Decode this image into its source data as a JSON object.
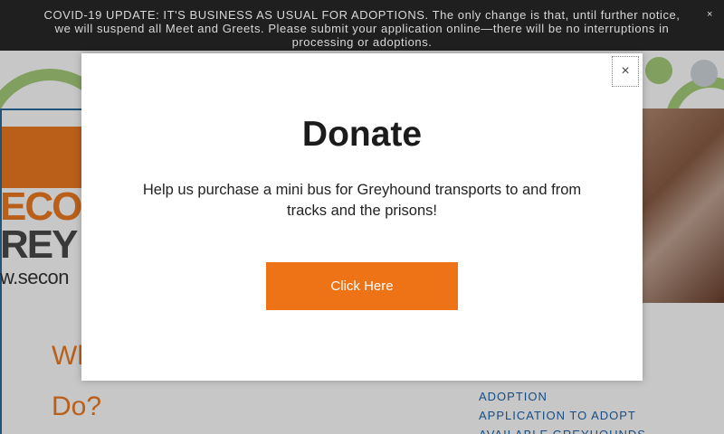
{
  "notice_bar": {
    "text": "COVID-19 UPDATE: IT'S BUSINESS AS USUAL FOR ADOPTIONS. The only change is that, until further notice, we will suspend all Meet and Greets. Please submit your application online—there will be no interruptions in processing or adoptions.",
    "close_glyph": "×"
  },
  "page": {
    "logo_line1": "ECO",
    "logo_line2": "REY",
    "logo_url": "w.secon",
    "heading_line1": "Wh",
    "heading_line2": "Do?",
    "side_links": [
      "ADOPTION",
      "APPLICATION TO ADOPT",
      "AVAILABLE GREYHOUNDS"
    ],
    "colors": {
      "brand_orange": "#ee7a22",
      "link_blue": "#1f63a8",
      "accent_green": "#a6cc7a"
    }
  },
  "modal": {
    "close_glyph": "×",
    "title": "Donate",
    "body": "Help us purchase a mini bus for Greyhound transports to and from tracks and the prisons!",
    "cta_label": "Click Here",
    "cta_color": "#ee7317"
  }
}
